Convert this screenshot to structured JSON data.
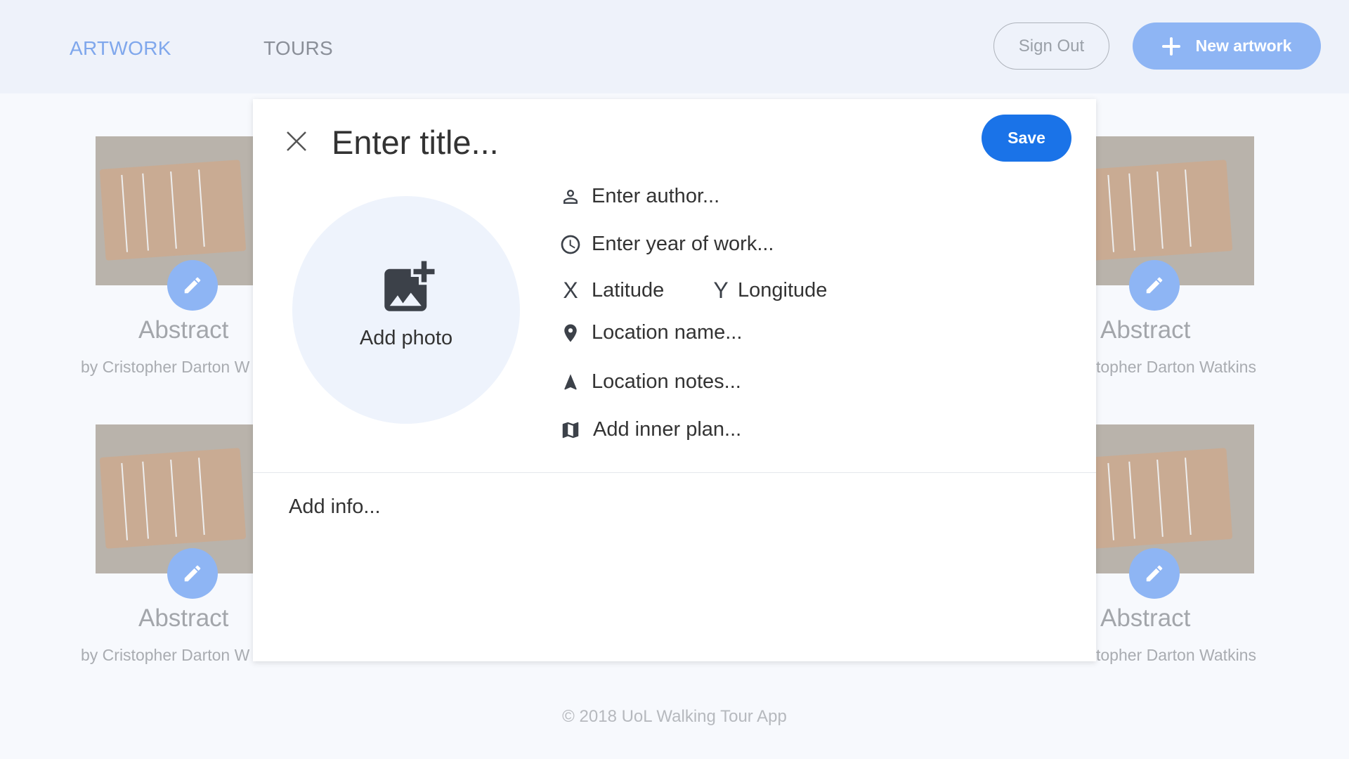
{
  "header": {
    "nav": {
      "artwork": "ARTWORK",
      "tours": "TOURS"
    },
    "sign_out": "Sign Out",
    "new_artwork": "New artwork"
  },
  "cards": {
    "title": "Abstract",
    "by_left": "by Cristopher Darton W",
    "by_right": "topher Darton Watkins"
  },
  "modal": {
    "title_placeholder": "Enter title...",
    "save": "Save",
    "add_photo": "Add photo",
    "author_placeholder": "Enter author...",
    "year_placeholder": "Enter year of work...",
    "latitude_letter": "X",
    "latitude_placeholder": "Latitude",
    "longitude_letter": "Y",
    "longitude_placeholder": "Longitude",
    "location_name_placeholder": "Location name...",
    "location_notes_placeholder": "Location notes...",
    "inner_plan_placeholder": "Add inner plan...",
    "info_placeholder": "Add info..."
  },
  "footer": "© 2018 UoL Walking Tour App",
  "colors": {
    "accent": "#1a73e8",
    "accent_light": "#8eb5f4",
    "nav_active": "#7fa7ec"
  }
}
